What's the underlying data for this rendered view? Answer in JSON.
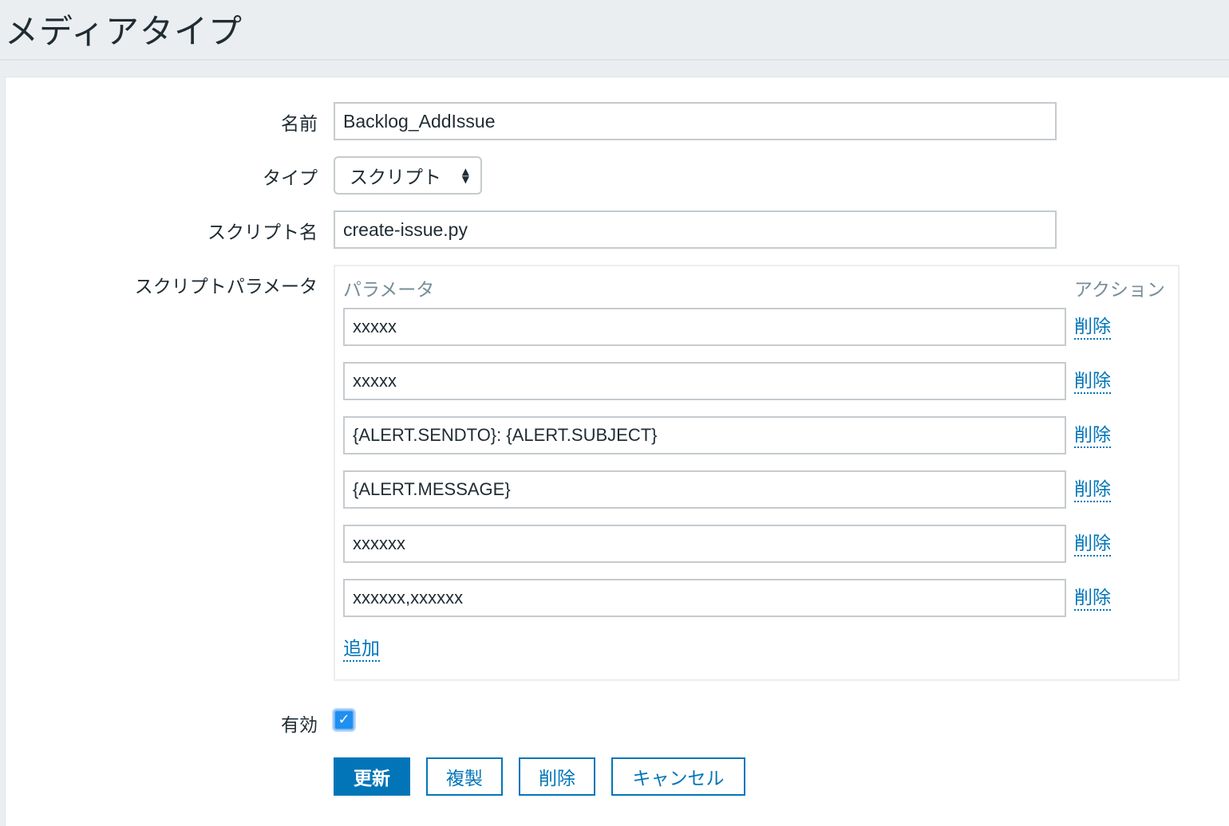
{
  "page": {
    "title": "メディアタイプ"
  },
  "form": {
    "name_label": "名前",
    "name_value": "Backlog_AddIssue",
    "type_label": "タイプ",
    "type_value": "スクリプト",
    "script_name_label": "スクリプト名",
    "script_name_value": "create-issue.py",
    "script_params_label": "スクリプトパラメータ",
    "params_table": {
      "col_parameter": "パラメータ",
      "col_action": "アクション",
      "rows": [
        {
          "value": "xxxxx",
          "action": "削除"
        },
        {
          "value": "xxxxx",
          "action": "削除"
        },
        {
          "value": "{ALERT.SENDTO}: {ALERT.SUBJECT}",
          "action": "削除"
        },
        {
          "value": "{ALERT.MESSAGE}",
          "action": "削除"
        },
        {
          "value": "xxxxxx",
          "action": "削除"
        },
        {
          "value": "xxxxxx,xxxxxx",
          "action": "削除"
        }
      ],
      "add_link": "追加"
    },
    "enabled_label": "有効",
    "enabled_checked": true,
    "enabled_check_glyph": "✓"
  },
  "buttons": {
    "update": "更新",
    "clone": "複製",
    "delete": "削除",
    "cancel": "キャンセル"
  },
  "colors": {
    "accent": "#0275b8",
    "checkbox": "#1f8ff0",
    "header_bg": "#ebeef0",
    "muted_text": "#768d99"
  }
}
